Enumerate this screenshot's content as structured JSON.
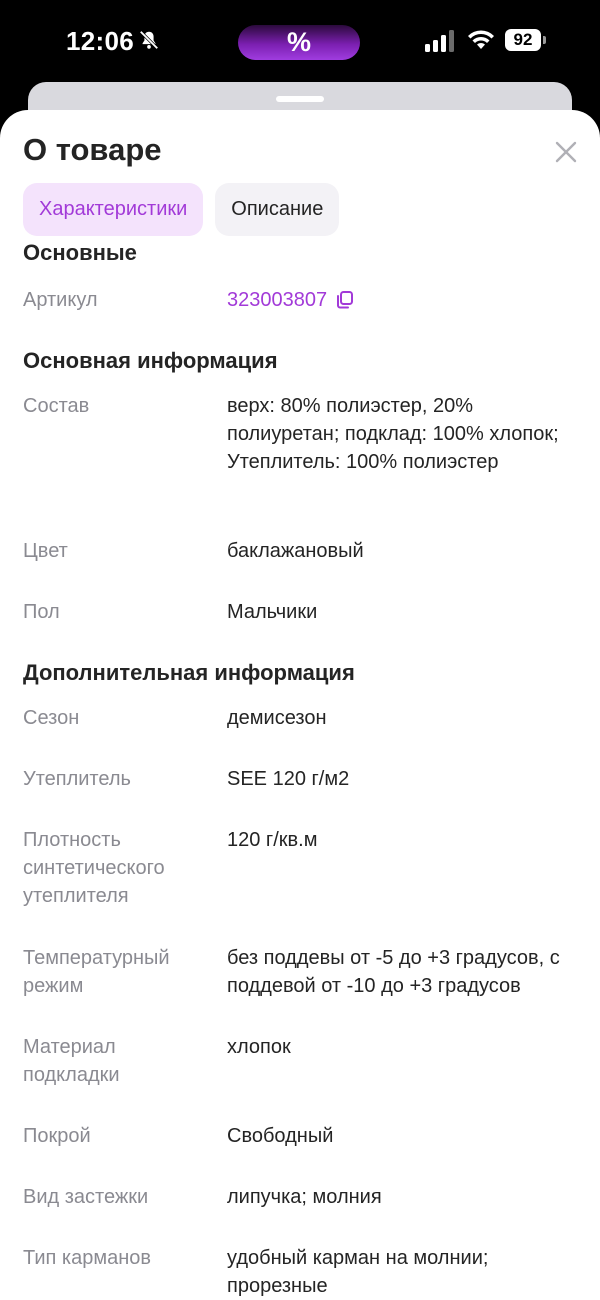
{
  "status_bar": {
    "time": "12:06",
    "promo_symbol": "%",
    "battery": "92"
  },
  "sheet": {
    "title": "О товаре",
    "tabs": [
      {
        "label": "Характеристики",
        "active": true
      },
      {
        "label": "Описание",
        "active": false
      }
    ]
  },
  "sections": {
    "basic": {
      "title": "Основные",
      "sku_label": "Артикул",
      "sku_value": "323003807"
    },
    "main_info": {
      "title": "Основная информация",
      "rows": [
        {
          "label": "Состав",
          "value": "верх: 80% полиэстер, 20% полиуретан; подклад: 100% хлопок; Утеплитель: 100% полиэстер"
        },
        {
          "label": "Цвет",
          "value": "баклажановый"
        },
        {
          "label": "Пол",
          "value": "Мальчики"
        }
      ]
    },
    "extra_info": {
      "title": "Дополнительная информация",
      "rows": [
        {
          "label": "Сезон",
          "value": "демисезон"
        },
        {
          "label": "Утеплитель",
          "value": "SEE 120 г/м2"
        },
        {
          "label": "Плотность синтетического утеплителя",
          "value": "120 г/кв.м"
        },
        {
          "label": "Температурный режим",
          "value": "без поддевы от -5 до +3 градусов, с поддевой от -10 до +3 градусов"
        },
        {
          "label": "Материал подкладки",
          "value": "хлопок"
        },
        {
          "label": "Покрой",
          "value": "Свободный"
        },
        {
          "label": "Вид застежки",
          "value": "липучка; молния"
        },
        {
          "label": "Тип карманов",
          "value": "удобный карман на молнии; прорезные"
        }
      ]
    }
  },
  "colors": {
    "accent": "#a23ad8",
    "accent_bg": "#f4e3fc",
    "text": "#242424",
    "muted": "#8a8a91"
  }
}
